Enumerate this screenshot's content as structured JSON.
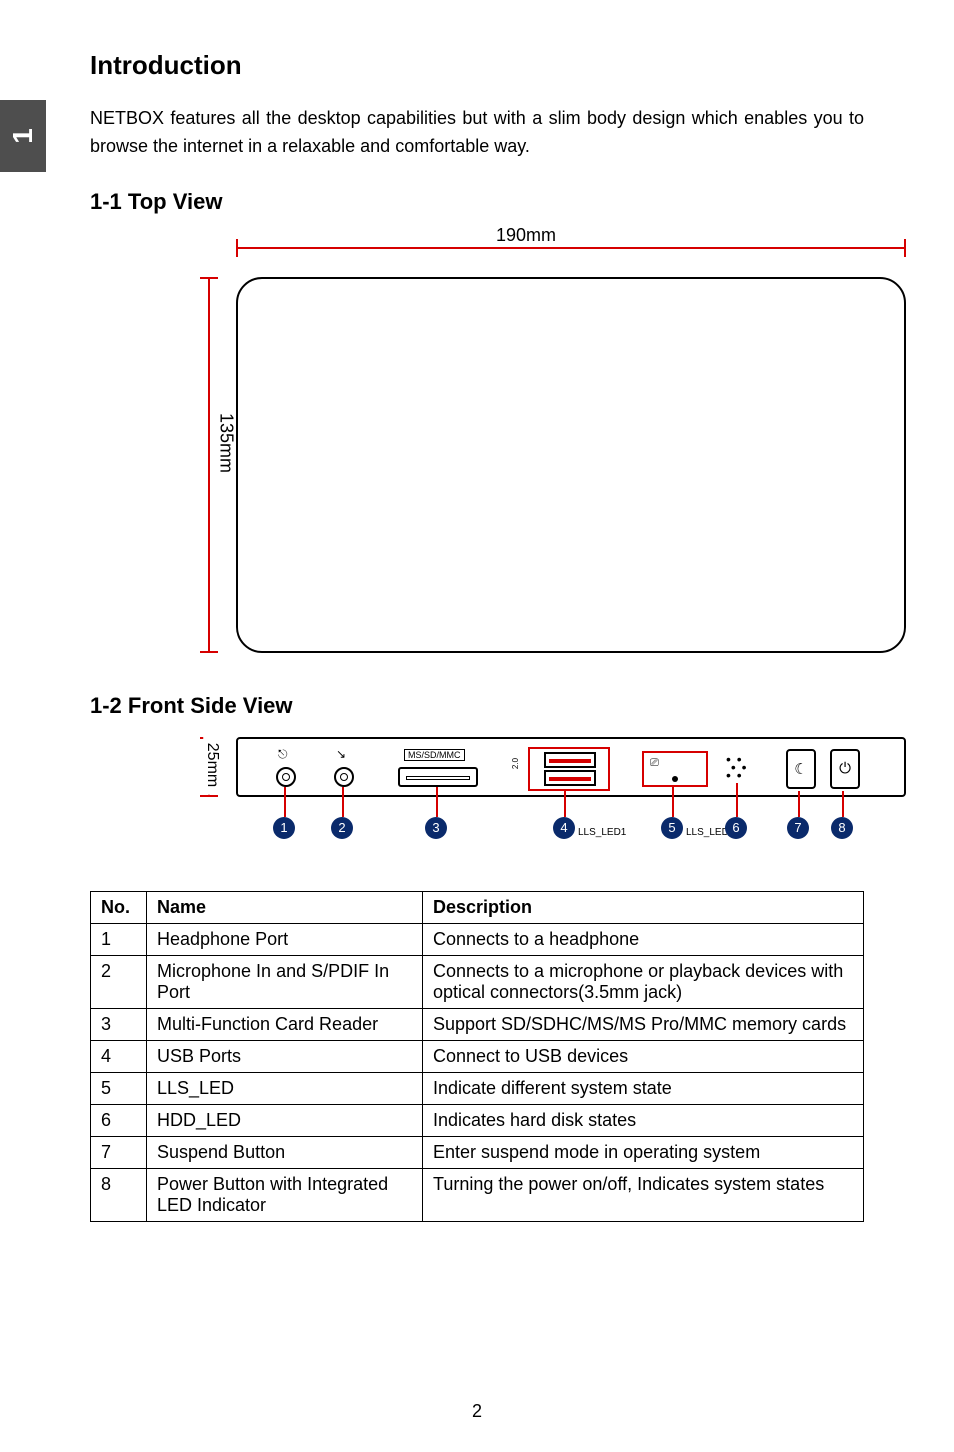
{
  "chapter_tab": "1",
  "headings": {
    "intro": "Introduction",
    "top_view": "1-1 Top View",
    "front_view": "1-2 Front Side View"
  },
  "intro_paragraph": "NETBOX features all the desktop capabilities but with a slim body design which enables you to browse the internet in a relaxable and comfortable way.",
  "top_view": {
    "width_label": "190mm",
    "height_label": "135mm"
  },
  "front_view": {
    "height_label": "25mm",
    "card_label": "MS/SD/MMC",
    "usb_icon": "2.0",
    "lls_icon": "⎚",
    "lls_led1": "LLS_LED1",
    "lls_led5": "LLS_LED5",
    "callouts": [
      "1",
      "2",
      "3",
      "4",
      "5",
      "6",
      "7",
      "8"
    ]
  },
  "table": {
    "headers": {
      "no": "No.",
      "name": "Name",
      "desc": "Description"
    },
    "rows": [
      {
        "no": "1",
        "name": "Headphone  Port",
        "desc": "Connects to a headphone"
      },
      {
        "no": "2",
        "name": "Microphone In and S/PDIF In Port",
        "desc": "Connects to a microphone or playback devices with optical connectors(3.5mm jack)"
      },
      {
        "no": "3",
        "name": "Multi-Function Card Reader",
        "desc": "Support SD/SDHC/MS/MS Pro/MMC memory cards"
      },
      {
        "no": "4",
        "name": "USB Ports",
        "desc": "Connect to USB devices"
      },
      {
        "no": "5",
        "name": "LLS_LED",
        "desc": "Indicate different system state"
      },
      {
        "no": "6",
        "name": "HDD_LED",
        "desc": "Indicates hard disk states"
      },
      {
        "no": "7",
        "name": "Suspend Button",
        "desc": "Enter suspend mode in operating system"
      },
      {
        "no": "8",
        "name": "Power Button with Integrated LED Indicator",
        "desc": "Turning the power on/off, Indicates system states"
      }
    ]
  },
  "page_number": "2"
}
